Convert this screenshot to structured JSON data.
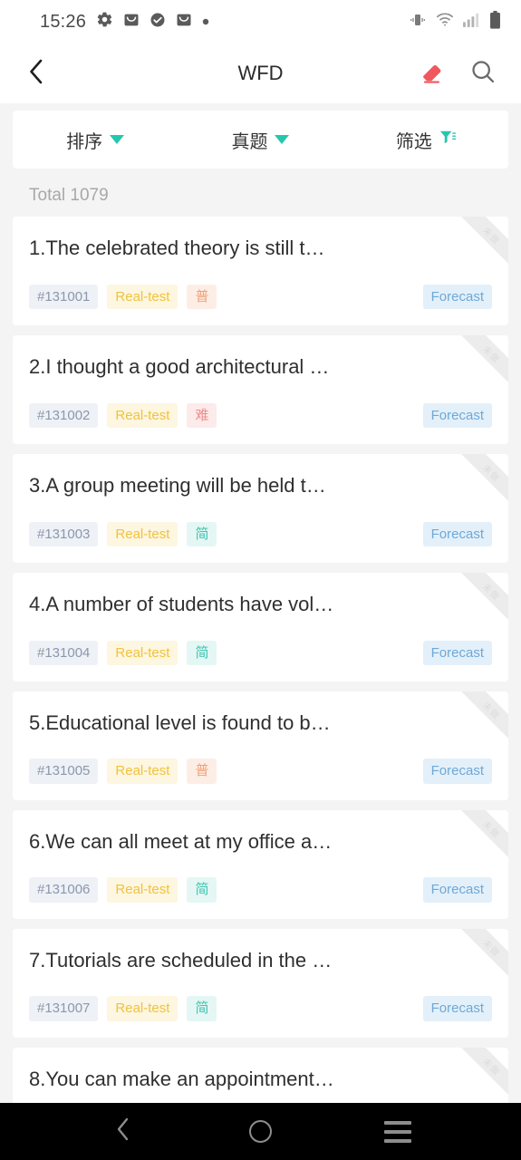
{
  "status_bar": {
    "time": "15:26",
    "left_icons": [
      "gear-icon",
      "mail-icon",
      "check-circle-icon",
      "mail-icon",
      "dot-icon"
    ],
    "right_icons": [
      "vibrate-icon",
      "wifi-icon",
      "signal-icon",
      "battery-icon"
    ]
  },
  "header": {
    "back_icon": "chevron-left-icon",
    "title": "WFD",
    "eraser_icon": "eraser-icon",
    "search_icon": "search-icon"
  },
  "filters": [
    {
      "label": "排序",
      "icon": "chevron-down-icon",
      "name": "sort"
    },
    {
      "label": "真题",
      "icon": "chevron-down-icon",
      "name": "real-test"
    },
    {
      "label": "筛选",
      "icon": "filter-icon",
      "name": "screen"
    }
  ],
  "accent_color": "#26c6ae",
  "total_label": "Total 1079",
  "ribbon_label": "未做",
  "items": [
    {
      "title": "1.The celebrated theory is still t…",
      "id": "#131001",
      "type": "Real-test",
      "difficulty": "普",
      "difficulty_class": "tag-diff-p",
      "forecast": "Forecast",
      "ribbon": "未做"
    },
    {
      "title": "2.I thought a good architectural …",
      "id": "#131002",
      "type": "Real-test",
      "difficulty": "难",
      "difficulty_class": "tag-diff-n",
      "forecast": "Forecast",
      "ribbon": "未做"
    },
    {
      "title": "3.A group meeting will be held t…",
      "id": "#131003",
      "type": "Real-test",
      "difficulty": "简",
      "difficulty_class": "tag-diff-j",
      "forecast": "Forecast",
      "ribbon": "未做"
    },
    {
      "title": "4.A number of students have vol…",
      "id": "#131004",
      "type": "Real-test",
      "difficulty": "简",
      "difficulty_class": "tag-diff-j",
      "forecast": "Forecast",
      "ribbon": "未做"
    },
    {
      "title": "5.Educational level is found to b…",
      "id": "#131005",
      "type": "Real-test",
      "difficulty": "普",
      "difficulty_class": "tag-diff-p",
      "forecast": "Forecast",
      "ribbon": "未做"
    },
    {
      "title": "6.We can all meet at my office a…",
      "id": "#131006",
      "type": "Real-test",
      "difficulty": "简",
      "difficulty_class": "tag-diff-j",
      "forecast": "Forecast",
      "ribbon": "未做"
    },
    {
      "title": "7.Tutorials are scheduled in the …",
      "id": "#131007",
      "type": "Real-test",
      "difficulty": "简",
      "difficulty_class": "tag-diff-j",
      "forecast": "Forecast",
      "ribbon": "未做"
    },
    {
      "title": "8.You can make an appointment…",
      "id": "",
      "type": "",
      "difficulty": "",
      "difficulty_class": "tag-diff-j",
      "forecast": "",
      "ribbon": "未做"
    }
  ],
  "nav_bar": {
    "back_icon": "nav-back-icon",
    "home_icon": "nav-home-icon",
    "recents_icon": "nav-recents-icon"
  }
}
